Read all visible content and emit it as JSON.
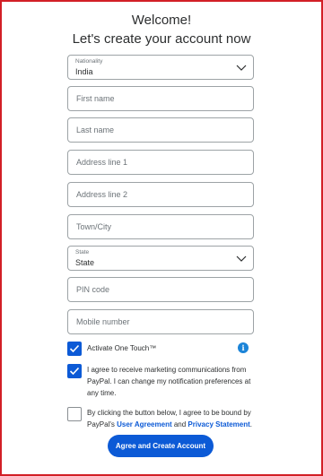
{
  "header": {
    "welcome": "Welcome!",
    "subtitle": "Let's create your account now"
  },
  "form": {
    "nationality": {
      "label": "Nationality",
      "value": "India"
    },
    "first_name": {
      "placeholder": "First name"
    },
    "last_name": {
      "placeholder": "Last name"
    },
    "address1": {
      "placeholder": "Address line 1"
    },
    "address2": {
      "placeholder": "Address line 2"
    },
    "town": {
      "placeholder": "Town/City"
    },
    "state": {
      "label": "State",
      "value": "State"
    },
    "pin": {
      "placeholder": "PIN code"
    },
    "mobile": {
      "placeholder": "Mobile number"
    }
  },
  "checkboxes": {
    "one_touch": {
      "label": "Activate One Touch™",
      "checked": true
    },
    "marketing": {
      "label": "I agree to receive marketing communications from PayPal. I can change my notification preferences at any time.",
      "checked": true
    },
    "agreement": {
      "text_before": "By clicking the button below, I agree to be bound by PayPal's ",
      "user_agreement": "User Agreement",
      "and": " and ",
      "privacy_statement": "Privacy Statement",
      "period": ".",
      "checked": false
    }
  },
  "info_icon": {
    "glyph": "i"
  },
  "submit": {
    "label": "Agree and Create Account"
  },
  "colors": {
    "accent": "#0c5ad6",
    "frame": "#d21f26"
  }
}
